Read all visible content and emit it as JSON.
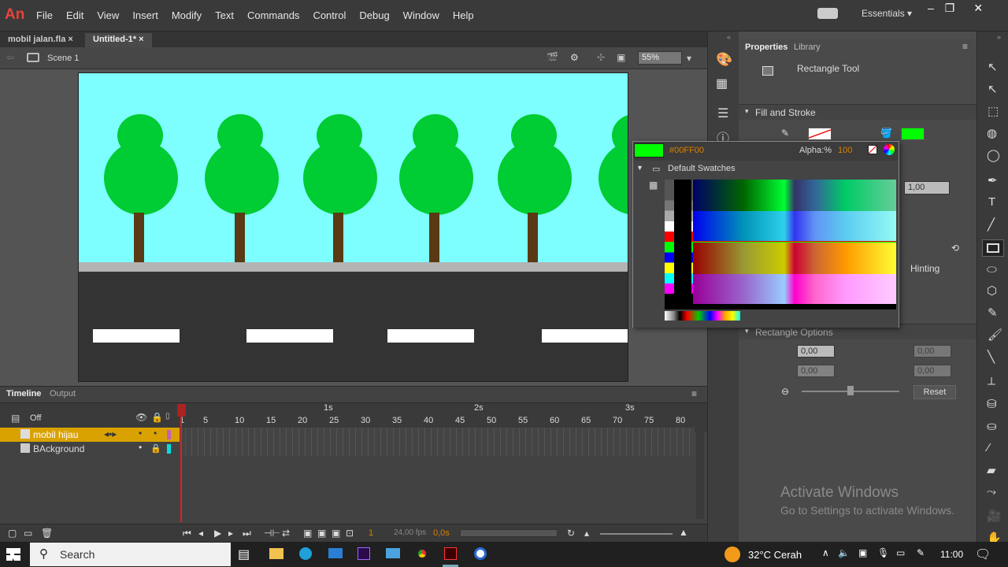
{
  "app": {
    "logo": "An"
  },
  "menu": [
    "File",
    "Edit",
    "View",
    "Insert",
    "Modify",
    "Text",
    "Commands",
    "Control",
    "Debug",
    "Window",
    "Help"
  ],
  "workspace": {
    "label": "Essentials"
  },
  "tabs": [
    {
      "label": "mobil jalan.fla",
      "close": "×"
    },
    {
      "label": "Untitled-1*",
      "close": "×"
    }
  ],
  "edit_bar": {
    "scene": "Scene 1",
    "zoom": "55%"
  },
  "properties": {
    "tab_properties": "Properties",
    "tab_library": "Library",
    "tool_name": "Rectangle Tool",
    "fill_stroke": "Fill and Stroke",
    "stroke_value": "1,00",
    "hinting": "Hinting",
    "rect_options": "Rectangle Options",
    "corner_tl": "0,00",
    "corner_bl": "0,00",
    "corner_tr": "0,00",
    "corner_br": "0,00",
    "reset": "Reset",
    "fill_color": "#00FF00"
  },
  "swatch_panel": {
    "hex": "#00FF00",
    "alpha_label": "Alpha:%",
    "alpha_value": "100",
    "group": "Default Swatches"
  },
  "timeline": {
    "tab_timeline": "Timeline",
    "tab_output": "Output",
    "off": "Off",
    "seconds": [
      "1s",
      "2s",
      "3s"
    ],
    "frames": [
      "1",
      "5",
      "10",
      "15",
      "20",
      "25",
      "30",
      "35",
      "40",
      "45",
      "50",
      "55",
      "60",
      "65",
      "70",
      "75",
      "80"
    ],
    "layers": [
      {
        "name": "mobil hijau",
        "color": "#c060c0"
      },
      {
        "name": "BAckground",
        "color": "#00e0e0"
      }
    ],
    "current_frame": "1",
    "fps": "24,00 fps",
    "time": "0,0s"
  },
  "watermark": {
    "title": "Activate Windows",
    "sub": "Go to Settings to activate Windows."
  },
  "taskbar": {
    "search": "Search",
    "weather": "32°C  Cerah",
    "clock": "11:00"
  }
}
